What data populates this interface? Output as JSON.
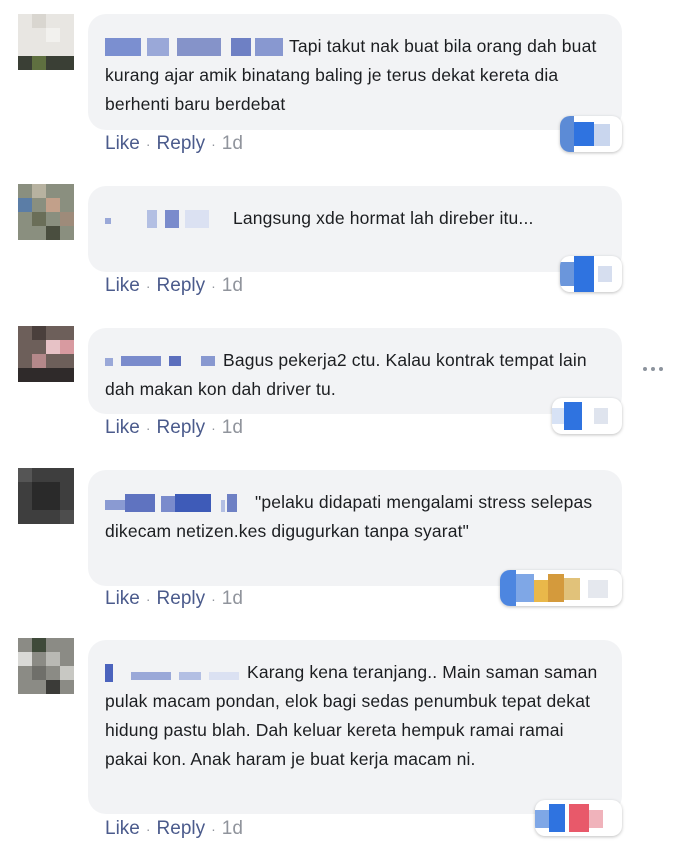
{
  "comments": [
    {
      "text": "Tapi takut nak buat bila orang dah buat kurang ajar amik binatang baling je terus dekat kereta dia berhenti baru berdebat",
      "like": "Like",
      "reply": "Reply",
      "sep": "·",
      "time": "1d"
    },
    {
      "text": "Langsung xde hormat lah direber itu...",
      "like": "Like",
      "reply": "Reply",
      "sep": "·",
      "time": "1d"
    },
    {
      "text": "Bagus pekerja2 ctu. Kalau kontrak tempat lain dah makan kon dah driver tu.",
      "like": "Like",
      "reply": "Reply",
      "sep": "·",
      "time": "1d"
    },
    {
      "text": "\"pelaku didapati mengalami stress selepas dikecam netizen.kes digugurkan tanpa syarat\"",
      "like": "Like",
      "reply": "Reply",
      "sep": "·",
      "time": "1d"
    },
    {
      "text": "Karang kena teranjang.. Main saman saman pulak macam pondan, elok bagi sedas penumbuk tepat dekat hidung pastu blah. Dah keluar kereta hempuk ramai ramai pakai kon. Anak haram je buat kerja macam ni.",
      "like": "Like",
      "reply": "Reply",
      "sep": "·",
      "time": "1d"
    }
  ],
  "colors": {
    "bubble": "#f2f3f5",
    "action_link": "#4b5b8c",
    "meta": "#90949c",
    "name_blur": "#7f8fc4"
  },
  "icons": {
    "more": "more-options-icon",
    "avatar": "avatar-blurred",
    "reactions": "reaction-count-blurred"
  }
}
